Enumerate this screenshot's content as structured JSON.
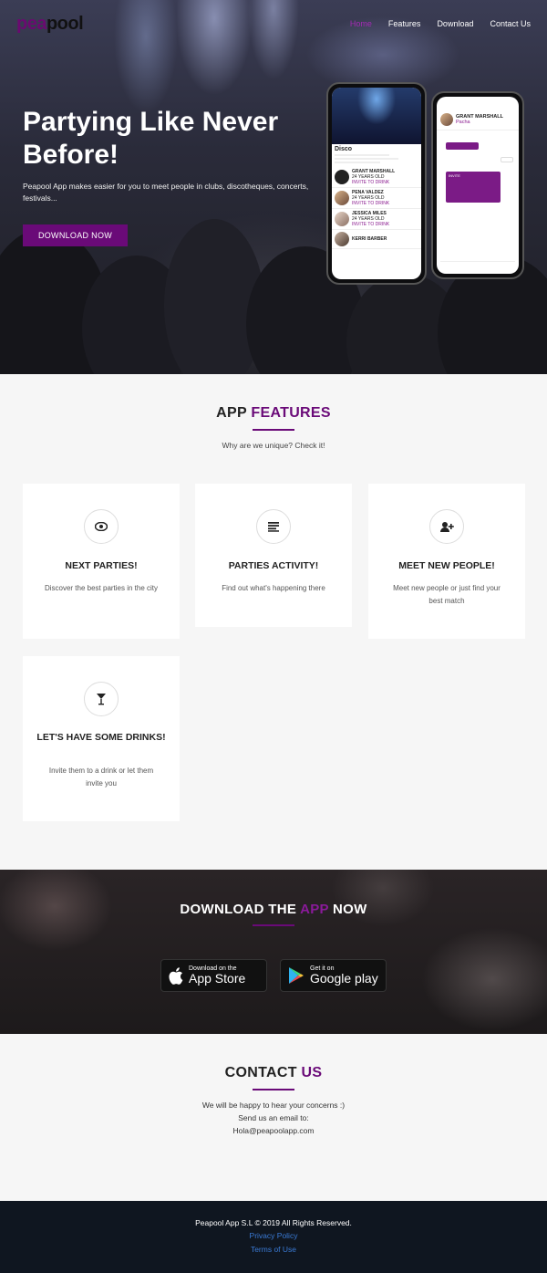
{
  "brand": {
    "logo_part1": "pea",
    "logo_part2": "pool"
  },
  "nav": {
    "items": [
      "Home",
      "Features",
      "Download",
      "Contact Us"
    ],
    "active": "Home"
  },
  "hero": {
    "title": "Partying Like Never Before!",
    "subtitle": "Peapool App makes easier for you to meet people in clubs, discotheques, concerts, festivals...",
    "button": "DOWNLOAD NOW"
  },
  "phone1": {
    "venue": "Disco",
    "rows": [
      {
        "name": "GRANT MARSHALL",
        "age": "24 YEARS OLD",
        "action": "INVITE TO DRINK"
      },
      {
        "name": "PENA VALDEZ",
        "age": "24 YEARS OLD",
        "action": "INVITE TO DRINK"
      },
      {
        "name": "JESSICA MILES",
        "age": "24 YEARS OLD",
        "action": "INVITE TO DRINK"
      },
      {
        "name": "KERRI BARBER",
        "age": "",
        "action": ""
      }
    ]
  },
  "phone2": {
    "name": "GRANT MARSHALL",
    "place": "Pacha",
    "invite": "INVITE"
  },
  "features": {
    "title_part1": "APP",
    "title_part2": "FEATURES",
    "subtitle": "Why are we unique? Check it!",
    "cards": [
      {
        "icon": "eye-icon",
        "title": "NEXT PARTIES!",
        "text": "Discover the best parties in the city"
      },
      {
        "icon": "list-icon",
        "title": "PARTIES ACTIVITY!",
        "text": "Find out what's happening there"
      },
      {
        "icon": "add-user-icon",
        "title": "MEET NEW PEOPLE!",
        "text": "Meet new people or just find your best match"
      },
      {
        "icon": "cocktail-icon",
        "title": "LET'S HAVE SOME DRINKS!",
        "text": "Invite them to a drink or let them invite you"
      }
    ]
  },
  "download": {
    "title_part1": "DOWNLOAD THE",
    "title_part2": "APP",
    "title_part3": "NOW",
    "appstore_small": "Download on the",
    "appstore_big": "App Store",
    "gplay_small": "Get it on",
    "gplay_big": "Google play"
  },
  "contact": {
    "title_part1": "CONTACT",
    "title_part2": "US",
    "line1": "We will be happy to hear your concerns :)",
    "line2": "Send us an email to:",
    "email": "Hola@peapoolapp.com"
  },
  "footer": {
    "copyright": "Peapool App S.L © 2019 All Rights Reserved.",
    "privacy": "Privacy Policy",
    "terms": "Terms of Use"
  },
  "colors": {
    "accent": "#6a0a78",
    "footer_bg": "#0f1620",
    "link": "#3b7bd6"
  }
}
